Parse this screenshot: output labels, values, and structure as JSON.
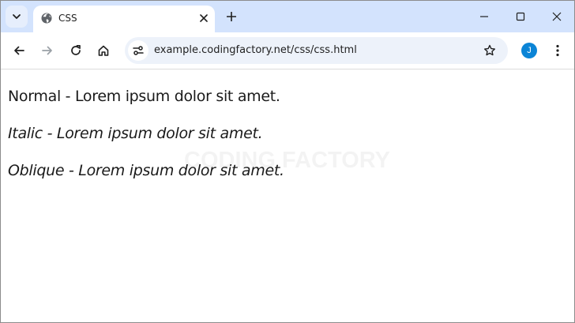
{
  "tab": {
    "title": "CSS"
  },
  "toolbar": {
    "url": "example.codingfactory.net/css/css.html",
    "avatar_letter": "J"
  },
  "content": {
    "normal": "Normal - Lorem ipsum dolor sit amet.",
    "italic": "Italic - Lorem ipsum dolor sit amet.",
    "oblique": "Oblique - Lorem ipsum dolor sit amet."
  },
  "watermark": "CODING FACTORY",
  "colors": {
    "tabbar": "#d3e3fd",
    "omnibox": "#edf2fa",
    "avatar": "#0b84d6"
  },
  "icons": [
    "tab-search-icon",
    "globe-icon",
    "close-icon",
    "plus-icon",
    "minimize-icon",
    "maximize-icon",
    "window-close-icon",
    "back-icon",
    "forward-icon",
    "reload-icon",
    "home-icon",
    "site-settings-icon",
    "star-icon",
    "more-vert-icon"
  ]
}
